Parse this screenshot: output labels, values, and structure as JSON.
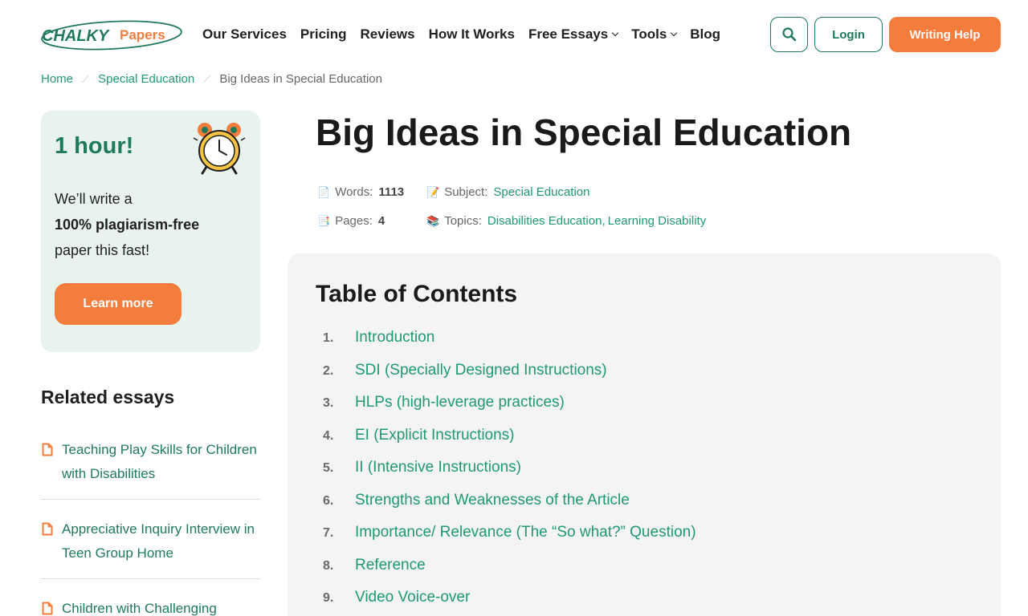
{
  "header": {
    "logo": {
      "part1": "CHALKY",
      "part2": "Papers"
    },
    "nav": [
      {
        "label": "Our Services",
        "dropdown": false
      },
      {
        "label": "Pricing",
        "dropdown": false
      },
      {
        "label": "Reviews",
        "dropdown": false
      },
      {
        "label": "How It Works",
        "dropdown": false
      },
      {
        "label": "Free Essays",
        "dropdown": true
      },
      {
        "label": "Tools",
        "dropdown": true
      },
      {
        "label": "Blog",
        "dropdown": false
      }
    ],
    "login_label": "Login",
    "help_label": "Writing Help"
  },
  "breadcrumb": {
    "home": "Home",
    "category": "Special Education",
    "current": "Big Ideas in Special Education"
  },
  "promo": {
    "title": "1 hour!",
    "line1": "We’ll write a",
    "line2": "100% plagiarism-free",
    "line3": "paper this fast!",
    "button": "Learn more"
  },
  "related": {
    "title": "Related essays",
    "items": [
      "Teaching Play Skills for Children with Disabilities",
      "Appreciative Inquiry Interview in Teen Group Home",
      "Children with Challenging"
    ]
  },
  "article": {
    "title": "Big Ideas in Special Education",
    "meta": {
      "words_label": "Words:",
      "words_value": "1113",
      "subject_label": "Subject:",
      "subject_value": "Special Education",
      "pages_label": "Pages:",
      "pages_value": "4",
      "topics_label": "Topics:",
      "topic1": "Disabilities Education",
      "topic_sep": ",",
      "topic2": "Learning Disability"
    }
  },
  "toc": {
    "title": "Table of Contents",
    "items": [
      {
        "num": "1.",
        "label": "Introduction"
      },
      {
        "num": "2.",
        "label": "SDI (Specially Designed Instructions)"
      },
      {
        "num": "3.",
        "label": "HLPs (high-leverage practices)"
      },
      {
        "num": "4.",
        "label": "EI (Explicit Instructions)"
      },
      {
        "num": "5.",
        "label": "II (Intensive Instructions)"
      },
      {
        "num": "6.",
        "label": "Strengths and Weaknesses of the Article"
      },
      {
        "num": "7.",
        "label": "Importance/ Relevance (The “So what?” Question)"
      },
      {
        "num": "8.",
        "label": "Reference"
      },
      {
        "num": "9.",
        "label": "Video Voice-over"
      }
    ]
  },
  "colors": {
    "brand_green": "#1f7a5a",
    "link_green": "#1f9a6f",
    "accent_orange": "#f47c3c",
    "promo_bg": "#e8f3ee",
    "toc_bg": "#f4f4f4"
  },
  "icons": {
    "search": "search-icon",
    "alarm": "alarm-clock-icon",
    "document": "document-icon",
    "words": "page-icon",
    "subject": "memo-icon",
    "pages": "bookmark-tabs-icon",
    "topics": "books-icon"
  }
}
